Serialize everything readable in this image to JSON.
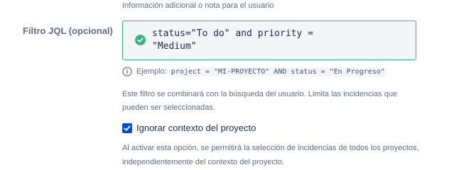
{
  "top_note": "Información adicional o nota para el usuario",
  "jql_field": {
    "label": "Filtro JQL (opcional)",
    "value": "status=\"To do\" and priority = \n\"Medium\"",
    "status": "valid",
    "status_icon": "check-circle-icon",
    "border_color": "#36b37e"
  },
  "example": {
    "icon": "info-icon",
    "label": "Ejemplo:",
    "code": "project = \"MI-PROYECTO\" AND status = \"En Progreso\""
  },
  "filter_help": "Este filtro se combinará con la búsqueda del usuario. Limita las incidencias que pueden ser seleccionadas.",
  "ignore_context": {
    "label": "Ignorar contexto del proyecto",
    "checked": true,
    "checkbox_color": "#0052cc"
  },
  "ignore_context_help": "Al activar esta opción, se permitirá la selección de incidencias de todos los proyectos, independientemente del contexto del proyecto."
}
